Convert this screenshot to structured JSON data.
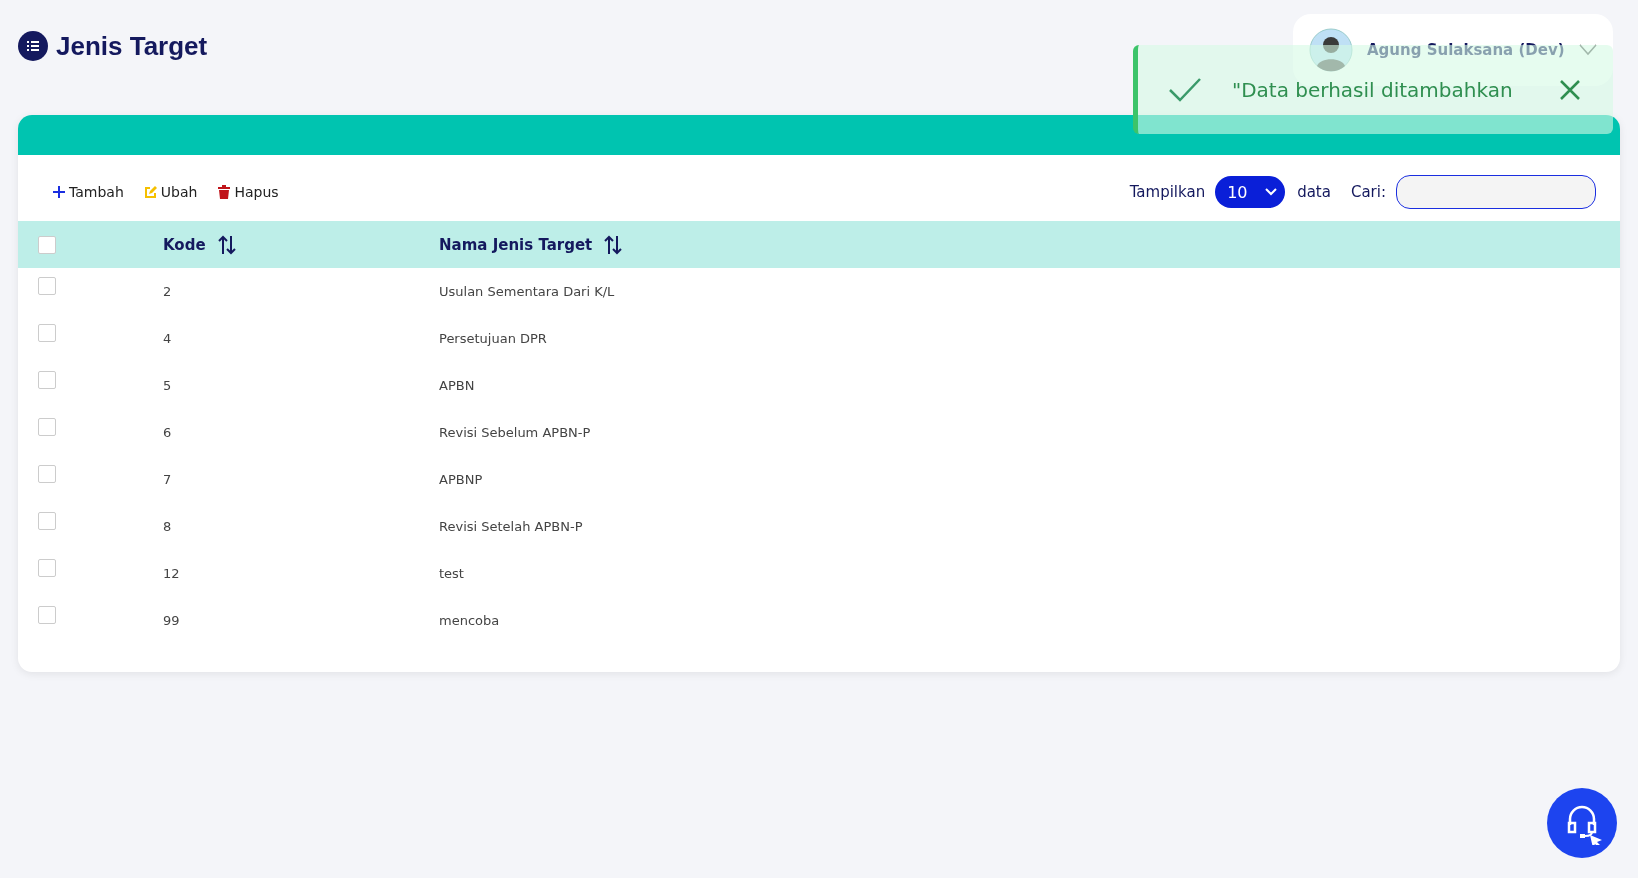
{
  "page": {
    "title": "Jenis Target"
  },
  "user": {
    "name": "Agung Sulaksana (Dev)"
  },
  "toast": {
    "message": "\"Data berhasil ditambahkan"
  },
  "toolbar": {
    "actions": [
      {
        "kind": "add",
        "label": "Tambah"
      },
      {
        "kind": "edit",
        "label": "Ubah"
      },
      {
        "kind": "delete",
        "label": "Hapus"
      }
    ],
    "page_size_label": "Tampilkan",
    "page_size": "10",
    "page_size_suffix": "data",
    "search_label": "Cari:"
  },
  "table": {
    "select_all_checked": false,
    "columns": [
      "Kode",
      "Nama Jenis Target"
    ],
    "rows": [
      {
        "checked": false,
        "cells": [
          "2",
          "Usulan Sementara Dari K/L"
        ]
      },
      {
        "checked": false,
        "cells": [
          "4",
          "Persetujuan DPR"
        ]
      },
      {
        "checked": false,
        "cells": [
          "5",
          "APBN"
        ]
      },
      {
        "checked": false,
        "cells": [
          "6",
          "Revisi Sebelum APBN-P"
        ]
      },
      {
        "checked": false,
        "cells": [
          "7",
          "APBNP"
        ]
      },
      {
        "checked": false,
        "cells": [
          "8",
          "Revisi Setelah APBN-P"
        ]
      },
      {
        "checked": false,
        "cells": [
          "12",
          "test"
        ]
      },
      {
        "checked": false,
        "cells": [
          "99",
          "mencoba"
        ]
      }
    ]
  }
}
